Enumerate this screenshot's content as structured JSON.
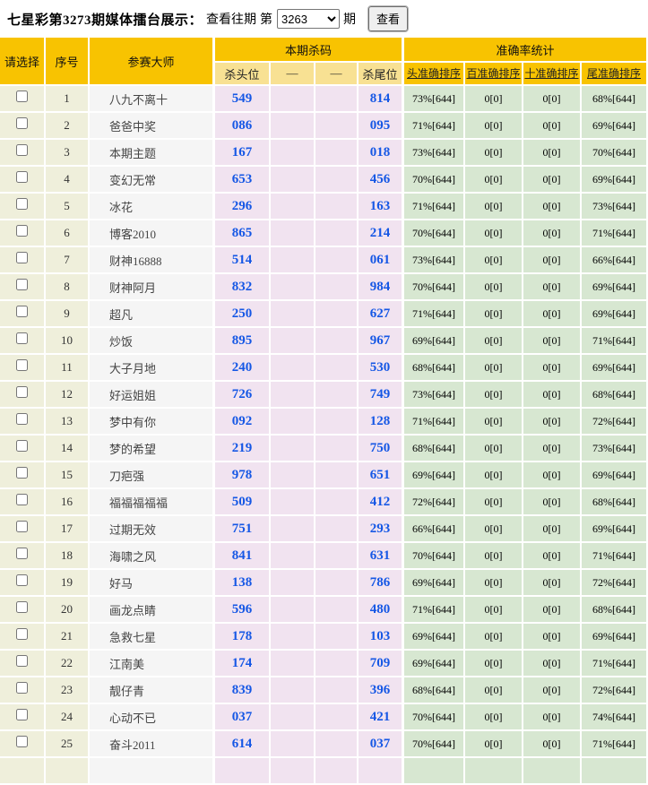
{
  "header": {
    "title": "七星彩第3273期媒体擂台展示：",
    "view_past": "查看往期",
    "issue_prefix": "第",
    "issue_value": "3263",
    "issue_suffix": "期",
    "view_button": "查看"
  },
  "colors": {
    "header_gold": "#f8c301",
    "subheader_yellow": "#f8e193",
    "select_column_bg": "#efefdb",
    "master_column_bg": "#f5f5f5",
    "kill_column_bg": "#f1e3f0",
    "accuracy_column_bg": "#d7e7d1",
    "number_blue": "#1557e5"
  },
  "table": {
    "headers": {
      "select": "请选择",
      "index": "序号",
      "master": "参赛大师",
      "kill_group": "本期杀码",
      "kill_sub": [
        "杀头位",
        "—",
        "—",
        "杀尾位"
      ],
      "accuracy_group": "准确率统计",
      "accuracy_sub": [
        "头准确排序",
        "百准确排序",
        "十准确排序",
        "尾准确排序"
      ]
    },
    "rows": [
      {
        "index": "1",
        "master": "八九不离十",
        "kill_head": "549",
        "kill_tail": "814",
        "acc": [
          "73%[644]",
          "0[0]",
          "0[0]",
          "68%[644]"
        ]
      },
      {
        "index": "2",
        "master": "爸爸中奖",
        "kill_head": "086",
        "kill_tail": "095",
        "acc": [
          "71%[644]",
          "0[0]",
          "0[0]",
          "69%[644]"
        ]
      },
      {
        "index": "3",
        "master": "本期主题",
        "kill_head": "167",
        "kill_tail": "018",
        "acc": [
          "73%[644]",
          "0[0]",
          "0[0]",
          "70%[644]"
        ]
      },
      {
        "index": "4",
        "master": "变幻无常",
        "kill_head": "653",
        "kill_tail": "456",
        "acc": [
          "70%[644]",
          "0[0]",
          "0[0]",
          "69%[644]"
        ]
      },
      {
        "index": "5",
        "master": "冰花",
        "kill_head": "296",
        "kill_tail": "163",
        "acc": [
          "71%[644]",
          "0[0]",
          "0[0]",
          "73%[644]"
        ]
      },
      {
        "index": "6",
        "master": "博客2010",
        "kill_head": "865",
        "kill_tail": "214",
        "acc": [
          "70%[644]",
          "0[0]",
          "0[0]",
          "71%[644]"
        ]
      },
      {
        "index": "7",
        "master": "财神16888",
        "kill_head": "514",
        "kill_tail": "061",
        "acc": [
          "73%[644]",
          "0[0]",
          "0[0]",
          "66%[644]"
        ]
      },
      {
        "index": "8",
        "master": "财神阿月",
        "kill_head": "832",
        "kill_tail": "984",
        "acc": [
          "70%[644]",
          "0[0]",
          "0[0]",
          "69%[644]"
        ]
      },
      {
        "index": "9",
        "master": "超凡",
        "kill_head": "250",
        "kill_tail": "627",
        "acc": [
          "71%[644]",
          "0[0]",
          "0[0]",
          "69%[644]"
        ]
      },
      {
        "index": "10",
        "master": "炒饭",
        "kill_head": "895",
        "kill_tail": "967",
        "acc": [
          "69%[644]",
          "0[0]",
          "0[0]",
          "71%[644]"
        ]
      },
      {
        "index": "11",
        "master": "大子月地",
        "kill_head": "240",
        "kill_tail": "530",
        "acc": [
          "68%[644]",
          "0[0]",
          "0[0]",
          "69%[644]"
        ]
      },
      {
        "index": "12",
        "master": "好运姐姐",
        "kill_head": "726",
        "kill_tail": "749",
        "acc": [
          "73%[644]",
          "0[0]",
          "0[0]",
          "68%[644]"
        ]
      },
      {
        "index": "13",
        "master": "梦中有你",
        "kill_head": "092",
        "kill_tail": "128",
        "acc": [
          "71%[644]",
          "0[0]",
          "0[0]",
          "72%[644]"
        ]
      },
      {
        "index": "14",
        "master": "梦的希望",
        "kill_head": "219",
        "kill_tail": "750",
        "acc": [
          "68%[644]",
          "0[0]",
          "0[0]",
          "73%[644]"
        ]
      },
      {
        "index": "15",
        "master": "刀疤强",
        "kill_head": "978",
        "kill_tail": "651",
        "acc": [
          "69%[644]",
          "0[0]",
          "0[0]",
          "69%[644]"
        ]
      },
      {
        "index": "16",
        "master": "福福福福福",
        "kill_head": "509",
        "kill_tail": "412",
        "acc": [
          "72%[644]",
          "0[0]",
          "0[0]",
          "68%[644]"
        ]
      },
      {
        "index": "17",
        "master": "过期无效",
        "kill_head": "751",
        "kill_tail": "293",
        "acc": [
          "66%[644]",
          "0[0]",
          "0[0]",
          "69%[644]"
        ]
      },
      {
        "index": "18",
        "master": "海啸之风",
        "kill_head": "841",
        "kill_tail": "631",
        "acc": [
          "70%[644]",
          "0[0]",
          "0[0]",
          "71%[644]"
        ]
      },
      {
        "index": "19",
        "master": "好马",
        "kill_head": "138",
        "kill_tail": "786",
        "acc": [
          "69%[644]",
          "0[0]",
          "0[0]",
          "72%[644]"
        ]
      },
      {
        "index": "20",
        "master": "画龙点睛",
        "kill_head": "596",
        "kill_tail": "480",
        "acc": [
          "71%[644]",
          "0[0]",
          "0[0]",
          "68%[644]"
        ]
      },
      {
        "index": "21",
        "master": "急救七星",
        "kill_head": "178",
        "kill_tail": "103",
        "acc": [
          "69%[644]",
          "0[0]",
          "0[0]",
          "69%[644]"
        ]
      },
      {
        "index": "22",
        "master": "江南美",
        "kill_head": "174",
        "kill_tail": "709",
        "acc": [
          "69%[644]",
          "0[0]",
          "0[0]",
          "71%[644]"
        ]
      },
      {
        "index": "23",
        "master": "靓仔青",
        "kill_head": "839",
        "kill_tail": "396",
        "acc": [
          "68%[644]",
          "0[0]",
          "0[0]",
          "72%[644]"
        ]
      },
      {
        "index": "24",
        "master": "心动不已",
        "kill_head": "037",
        "kill_tail": "421",
        "acc": [
          "70%[644]",
          "0[0]",
          "0[0]",
          "74%[644]"
        ]
      },
      {
        "index": "25",
        "master": "奋斗2011",
        "kill_head": "614",
        "kill_tail": "037",
        "acc": [
          "70%[644]",
          "0[0]",
          "0[0]",
          "71%[644]"
        ]
      },
      {
        "index": "",
        "master": "",
        "kill_head": "",
        "kill_tail": "",
        "acc": [
          "",
          "",
          "",
          ""
        ]
      }
    ]
  }
}
